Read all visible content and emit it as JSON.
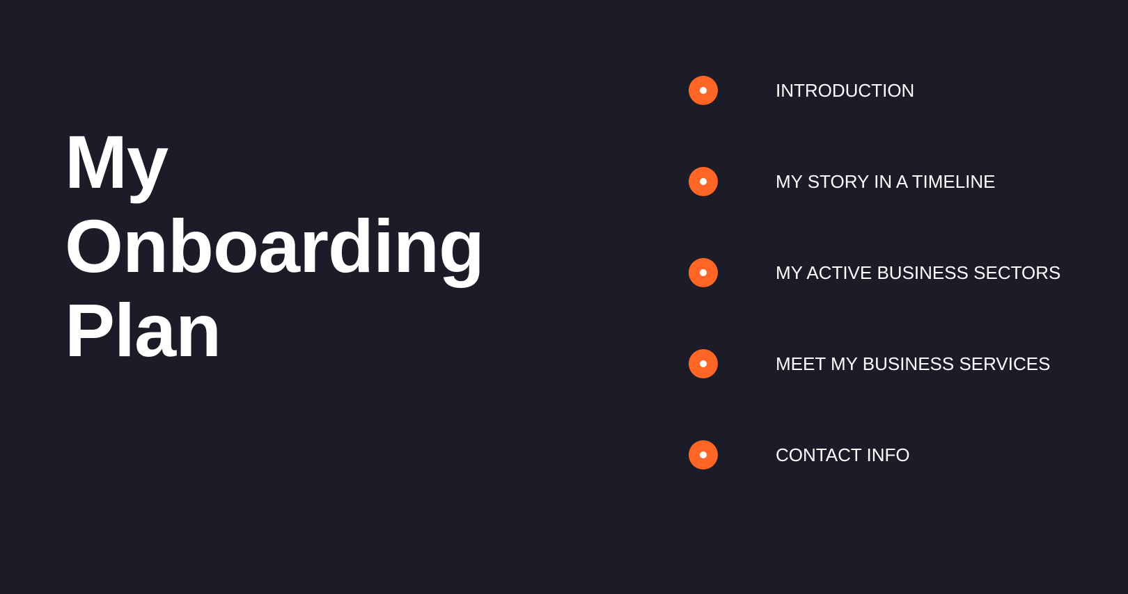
{
  "title": {
    "lines": [
      "My",
      "Onboarding",
      "Plan"
    ]
  },
  "agenda": {
    "items": [
      {
        "label": "INTRODUCTION",
        "icon": "bullet-dot-icon"
      },
      {
        "label": "MY STORY IN A TIMELINE",
        "icon": "bullet-dot-icon"
      },
      {
        "label": "MY ACTIVE BUSINESS SECTORS",
        "icon": "bullet-dot-icon"
      },
      {
        "label": "MEET MY BUSINESS SERVICES",
        "icon": "bullet-dot-icon"
      },
      {
        "label": "CONTACT INFO",
        "icon": "bullet-dot-icon"
      }
    ]
  },
  "colors": {
    "background": "#1b1c28",
    "accent": "#ff6525",
    "text": "#ffffff"
  }
}
